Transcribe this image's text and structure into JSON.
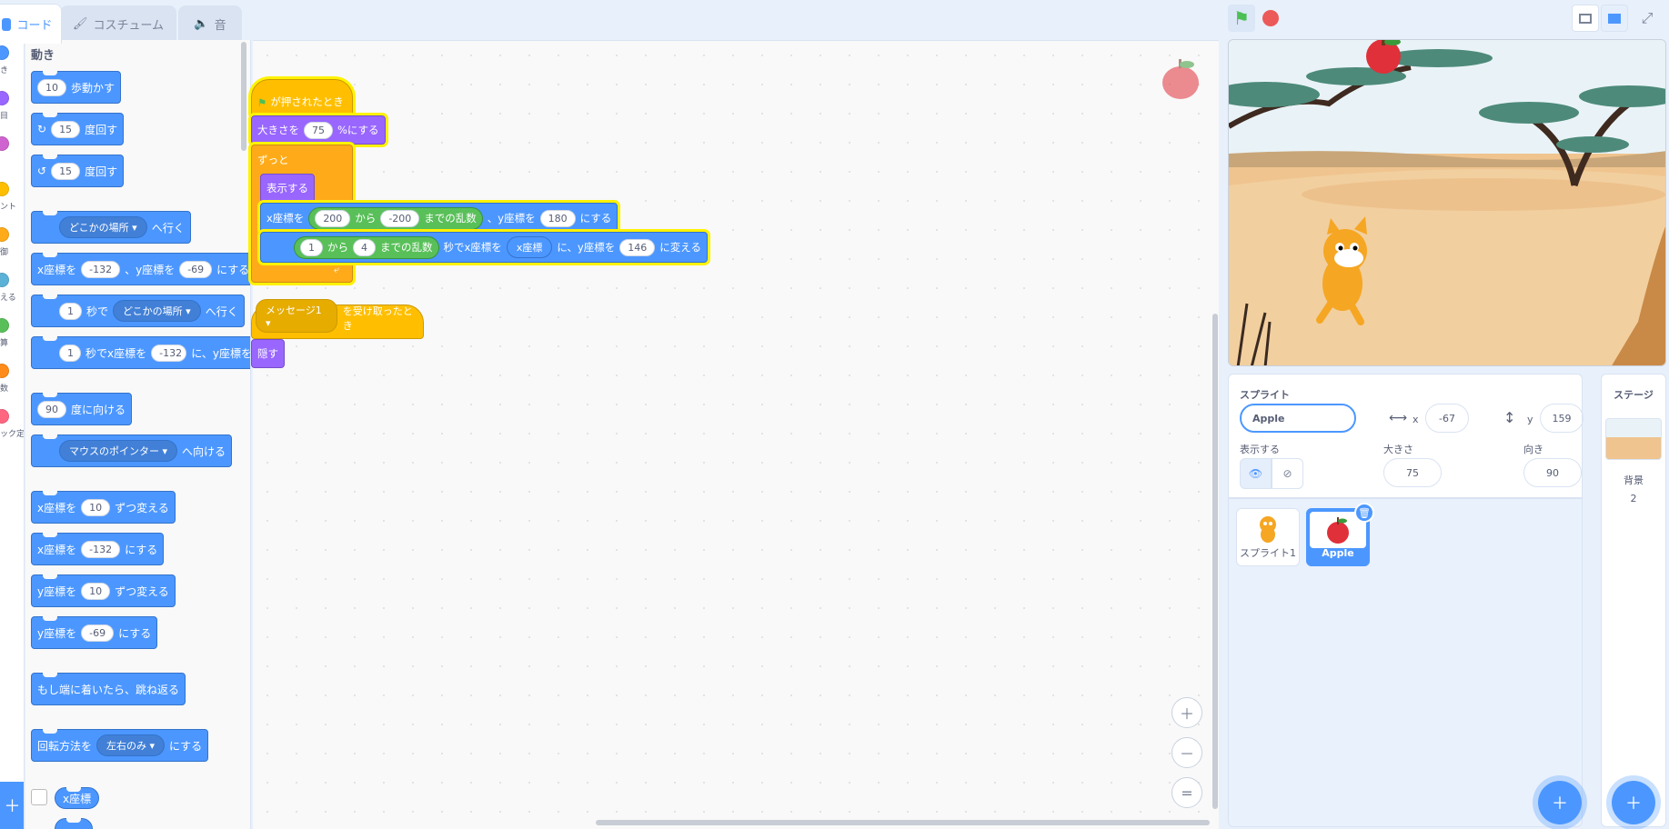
{
  "tabs": {
    "code": "コード",
    "costume": "コスチューム",
    "sound": "音"
  },
  "categories": [
    {
      "label": "き",
      "color": "#4c97ff"
    },
    {
      "label": "目",
      "color": "#9966ff"
    },
    {
      "label": "",
      "color": "#cf63cf"
    },
    {
      "label": "ント",
      "color": "#ffbf00"
    },
    {
      "label": "御",
      "color": "#ffab19"
    },
    {
      "label": "える",
      "color": "#5cb1d6"
    },
    {
      "label": "算",
      "color": "#59c059"
    },
    {
      "label": "数",
      "color": "#ff8c1a"
    },
    {
      "label": "ック定",
      "color": "#ff6680"
    }
  ],
  "palette": {
    "title": "動き",
    "move": {
      "v": "10",
      "t": "歩動かす"
    },
    "turn_right": {
      "v": "15",
      "t": "度回す"
    },
    "turn_left": {
      "v": "15",
      "t": "度回す"
    },
    "goto": {
      "dd": "どこかの場所",
      "t": "へ行く"
    },
    "goto_xy": {
      "a": "x座標を",
      "x": "-132",
      "b": "、y座標を",
      "y": "-69",
      "c": "にする"
    },
    "glide": {
      "v": "1",
      "a": "秒で",
      "dd": "どこかの場所",
      "b": "へ行く"
    },
    "glide_xy": {
      "v": "1",
      "a": "秒でx座標を",
      "x": "-132",
      "b": "に、y座標を"
    },
    "point": {
      "v": "90",
      "t": "度に向ける"
    },
    "point_towards": {
      "dd": "マウスのポインター",
      "t": "へ向ける"
    },
    "change_x": {
      "a": "x座標を",
      "v": "10",
      "b": "ずつ変える"
    },
    "set_x": {
      "a": "x座標を",
      "v": "-132",
      "b": "にする"
    },
    "change_y": {
      "a": "y座標を",
      "v": "10",
      "b": "ずつ変える"
    },
    "set_y": {
      "a": "y座標を",
      "v": "-69",
      "b": "にする"
    },
    "bounce": "もし端に着いたら、跳ね返る",
    "rotation": {
      "a": "回転方法を",
      "dd": "左右のみ",
      "b": "にする"
    },
    "xpos": "x座標"
  },
  "script1": {
    "hat": "が押されたとき",
    "size": {
      "a": "大きさを",
      "v": "75",
      "b": "%にする"
    },
    "forever": "ずっと",
    "show": "表示する",
    "setxy": {
      "a": "x座標を",
      "r1": "200",
      "r2": "から",
      "r3": "-200",
      "r4": "までの乱数",
      "b": "、y座標を",
      "y": "180",
      "c": "にする"
    },
    "glide": {
      "r1": "1",
      "r2": "から",
      "r3": "4",
      "r4": "までの乱数",
      "a": "秒でx座標を",
      "x": "x座標",
      "b": "に、y座標を",
      "y": "146",
      "c": "に変える"
    }
  },
  "script2": {
    "hat_dd": "メッセージ1",
    "hat": "を受け取ったとき",
    "hide": "隠す"
  },
  "zoom": {
    "in": "＋",
    "out": "－",
    "reset": "="
  },
  "sprite_info": {
    "label": "スプライト",
    "name": "Apple",
    "x_label": "x",
    "x": "-67",
    "y_label": "y",
    "y": "159",
    "show_label": "表示する",
    "size_label": "大きさ",
    "size": "75",
    "dir_label": "向き",
    "dir": "90"
  },
  "sprites": [
    {
      "name": "スプライト1"
    },
    {
      "name": "Apple"
    }
  ],
  "stage_panel": {
    "title": "ステージ",
    "backdrop_label": "背景",
    "backdrop_count": "2"
  }
}
